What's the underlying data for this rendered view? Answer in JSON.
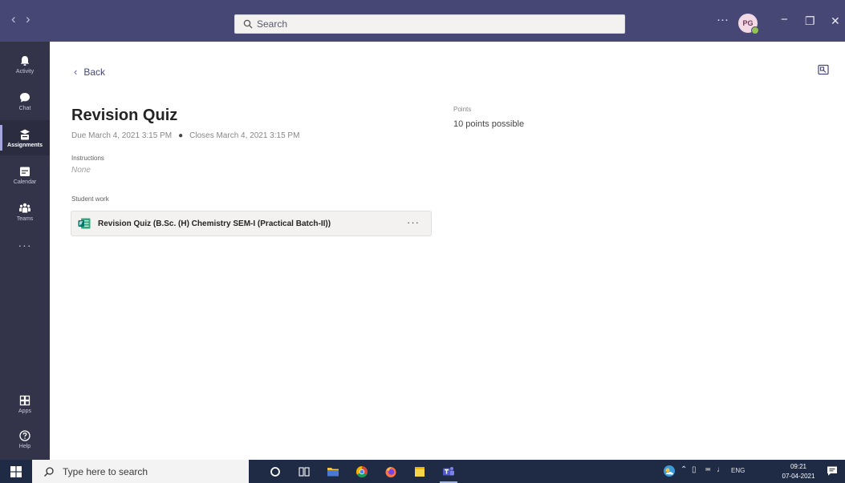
{
  "titlebar": {
    "search_placeholder": "Search",
    "more_label": "···",
    "avatar_initials": "PG",
    "minimize_label": "−",
    "restore_label": "❐",
    "close_label": "✕"
  },
  "rail": {
    "items": [
      {
        "label": "Activity"
      },
      {
        "label": "Chat"
      },
      {
        "label": "Assignments"
      },
      {
        "label": "Calendar"
      },
      {
        "label": "Teams"
      }
    ],
    "more_label": "···",
    "apps_label": "Apps",
    "help_label": "Help"
  },
  "main": {
    "back_label": "Back",
    "title": "Revision Quiz",
    "due_text": "Due March 4, 2021 3:15 PM",
    "closes_text": "Closes March 4, 2021 3:15 PM",
    "points_label": "Points",
    "points_value": "10 points possible",
    "instructions_label": "Instructions",
    "instructions_value": "None",
    "student_work_label": "Student work",
    "work_item": "Revision Quiz (B.Sc. (H) Chemistry SEM-I (Practical Batch-II))",
    "work_more": "···"
  },
  "taskbar": {
    "search_placeholder": "Type here to search",
    "language": "ENG",
    "time": "09:21",
    "date": "07-04-2021"
  },
  "colors": {
    "titlebar": "#464775",
    "rail": "#33344a",
    "accent": "#6264a7",
    "taskbar": "#1f2a44"
  }
}
